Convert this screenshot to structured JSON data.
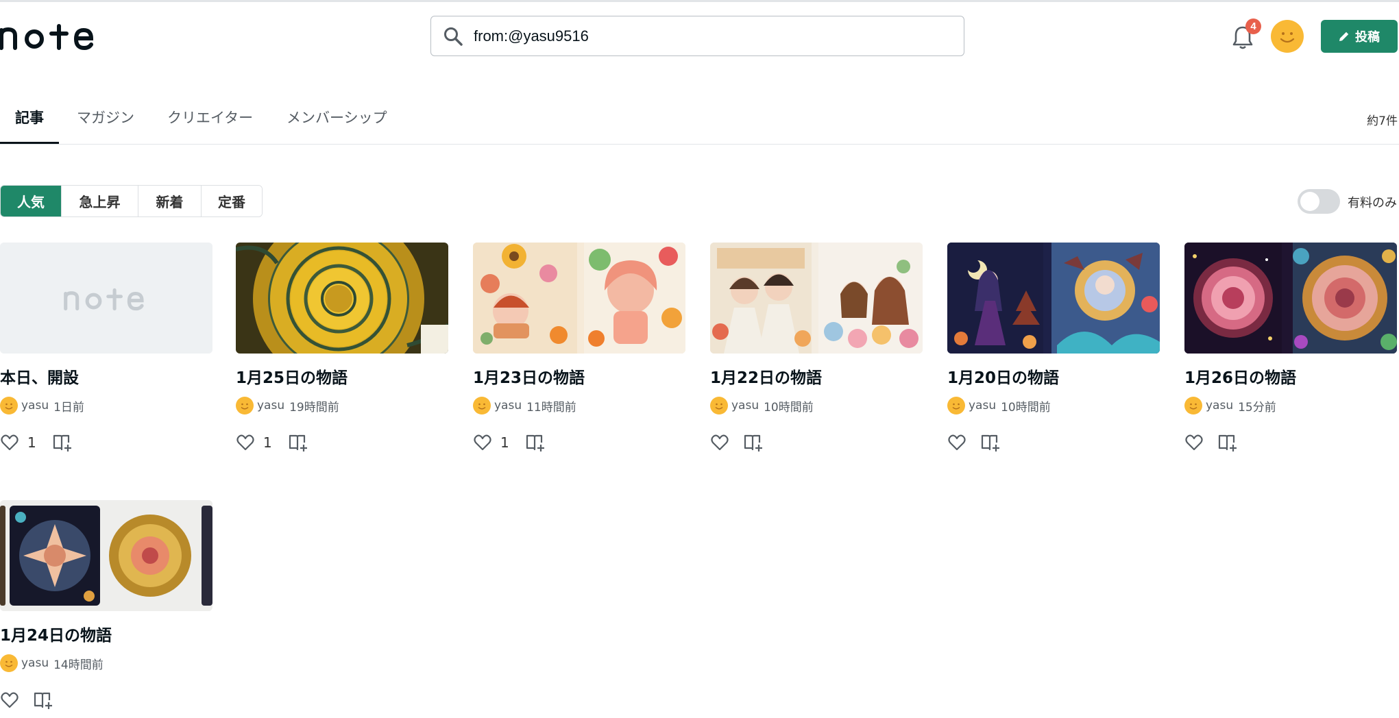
{
  "header": {
    "logo_text": "note",
    "search": {
      "value": "from:@yasu9516",
      "icon": "search-icon"
    },
    "notifications": {
      "icon": "bell-icon",
      "count": "4"
    },
    "user_avatar": "smile-avatar",
    "post_button": {
      "label": "投稿",
      "icon": "pencil-icon"
    }
  },
  "tabs": [
    {
      "label": "記事",
      "active": true
    },
    {
      "label": "マガジン",
      "active": false
    },
    {
      "label": "クリエイター",
      "active": false
    },
    {
      "label": "メンバーシップ",
      "active": false
    }
  ],
  "result_count": "約7件",
  "filters": [
    {
      "label": "人気",
      "active": true
    },
    {
      "label": "急上昇",
      "active": false
    },
    {
      "label": "新着",
      "active": false
    },
    {
      "label": "定番",
      "active": false
    }
  ],
  "paid_only": {
    "label": "有料のみ",
    "on": false
  },
  "articles": [
    {
      "title": "本日、開設",
      "author": "yasu",
      "time": "1日前",
      "likes": "1",
      "thumbnail": "note-placeholder"
    },
    {
      "title": "1月25日の物語",
      "author": "yasu",
      "time": "19時間前",
      "likes": "1",
      "thumbnail": "yellow-rose"
    },
    {
      "title": "1月23日の物語",
      "author": "yasu",
      "time": "11時間前",
      "likes": "1",
      "thumbnail": "flower-girls"
    },
    {
      "title": "1月22日の物語",
      "author": "yasu",
      "time": "10時間前",
      "likes": "",
      "thumbnail": "kimono-couple"
    },
    {
      "title": "1月20日の物語",
      "author": "yasu",
      "time": "10時間前",
      "likes": "",
      "thumbnail": "night-pagoda"
    },
    {
      "title": "1月26日の物語",
      "author": "yasu",
      "time": "15分前",
      "likes": "",
      "thumbnail": "mandala-flowers"
    },
    {
      "title": "1月24日の物語",
      "author": "yasu",
      "time": "14時間前",
      "likes": "",
      "thumbnail": "golden-mandalas"
    }
  ],
  "colors": {
    "accent": "#1f8868",
    "badge": "#e8604c",
    "avatar": "#f9b935"
  }
}
